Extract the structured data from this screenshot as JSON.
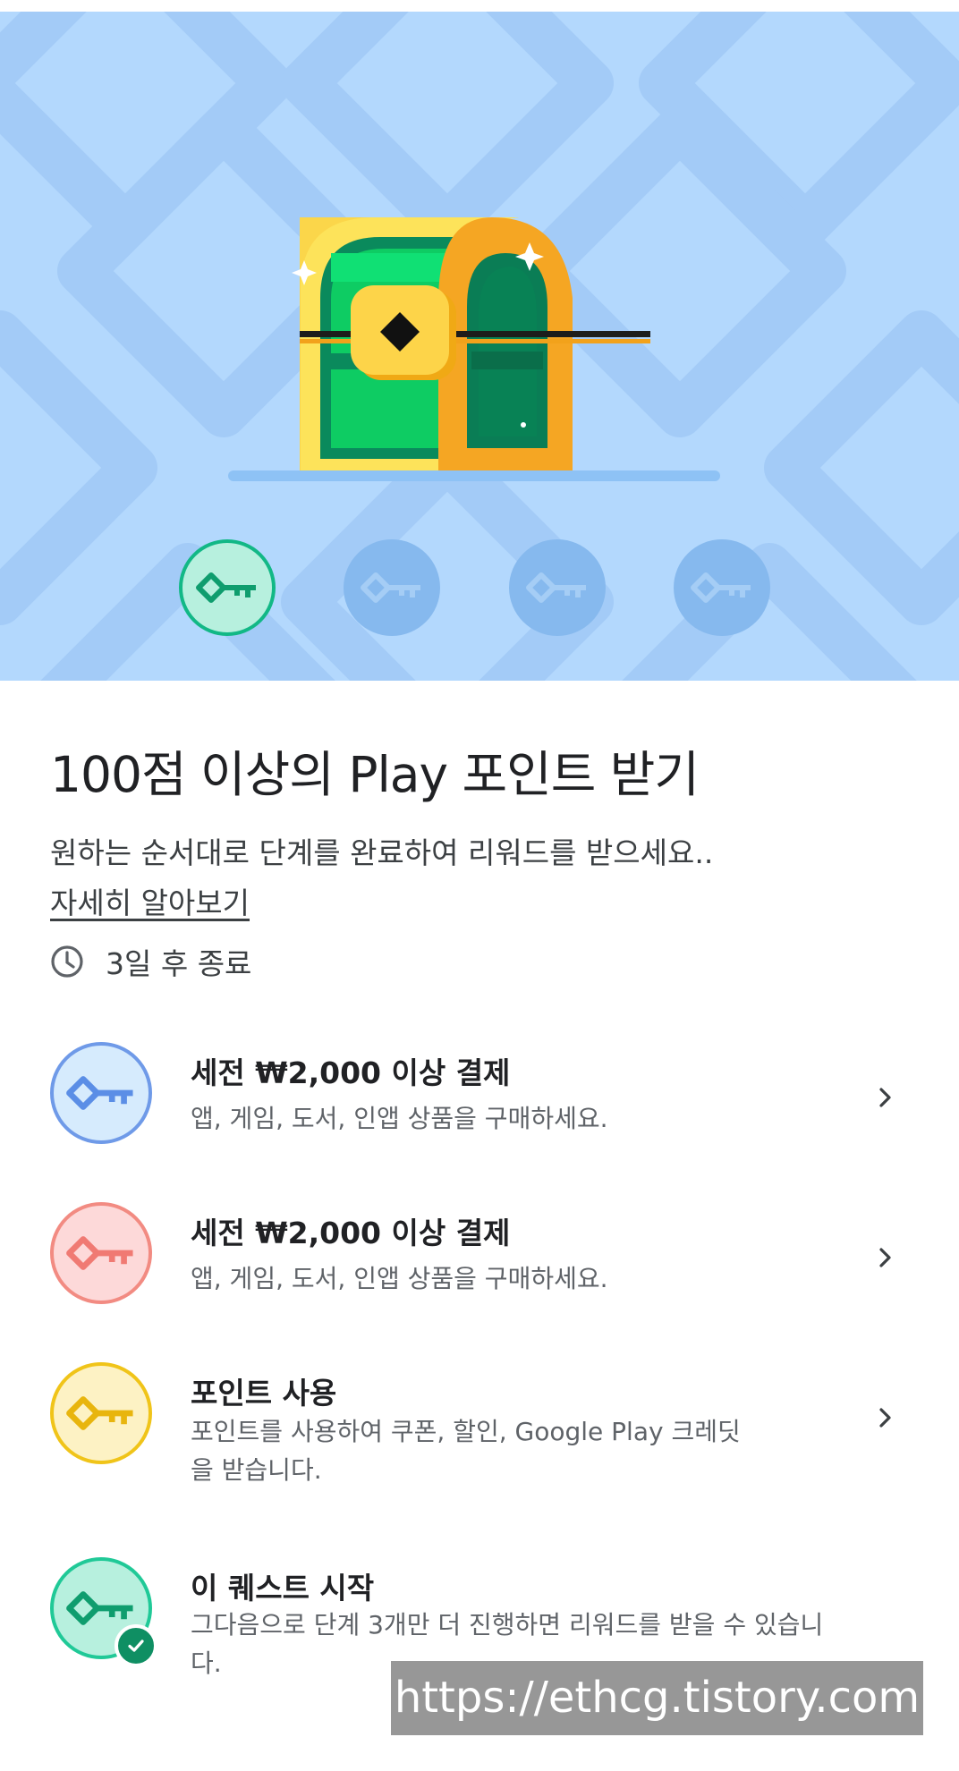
{
  "hero": {
    "image": "treasure-chest",
    "keys": [
      {
        "icon": "key-icon",
        "state": "collected"
      },
      {
        "icon": "key-icon",
        "state": "locked"
      },
      {
        "icon": "key-icon",
        "state": "locked"
      },
      {
        "icon": "key-icon",
        "state": "locked"
      }
    ]
  },
  "quest": {
    "title": "100점 이상의 Play 포인트 받기",
    "subtitle": "원하는 순서대로 단계를 완료하여 리워드를 받으세요..",
    "learn_more": "자세히 알아보기",
    "deadline_icon": "clock-icon",
    "deadline": "3일 후 종료"
  },
  "tasks": [
    {
      "title": "세전 ₩2,000 이상 결제",
      "desc": "앱, 게임, 도서, 인앱 상품을 구매하세요.",
      "color": "#6f9ae8",
      "bg": "#d6ebfd",
      "icon": "key-icon",
      "has_chevron": true
    },
    {
      "title": "세전 ₩2,000 이상 결제",
      "desc": "앱, 게임, 도서, 인앱 상품을 구매하세요.",
      "color": "#f28b82",
      "bg": "#fdd9d9",
      "icon": "key-icon",
      "has_chevron": true
    },
    {
      "title": "포인트 사용",
      "desc": "포인트를 사용하여 쿠폰, 할인, Google Play 크레딧을 받습니다.",
      "color": "#f0c419",
      "bg": "#fdf2c4",
      "icon": "key-icon",
      "has_chevron": true
    },
    {
      "title": "이 퀘스트 시작",
      "desc": "그다음으로 단계 3개만 더 진행하면 리워드를 받을 수 있습니다.",
      "color": "#20c997",
      "bg": "#b7f0de",
      "icon": "key-icon",
      "completed_icon": "check-icon",
      "has_chevron": false
    }
  ],
  "watermark": "https://ethcg.tistory.com",
  "colors": {
    "hero_bg": "#b3d8fd",
    "accent_green": "#12b886"
  }
}
